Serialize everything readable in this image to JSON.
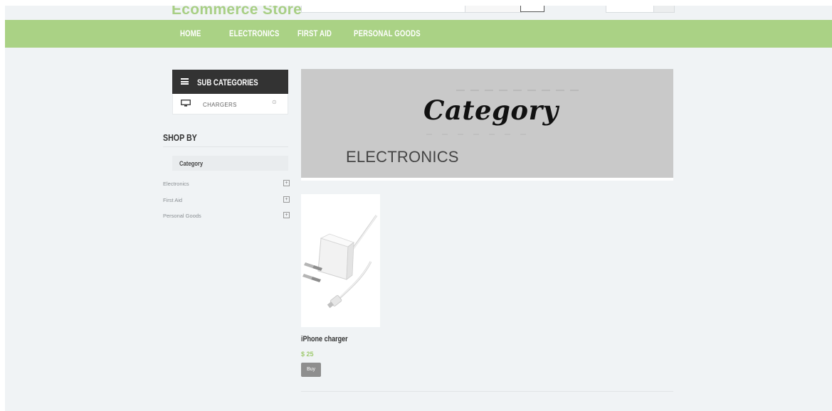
{
  "header": {
    "store_name": "Ecommerce Store"
  },
  "nav": {
    "items": [
      {
        "label": "HOME"
      },
      {
        "label": "ELECTRONICS"
      },
      {
        "label": "FIRST AID"
      },
      {
        "label": "PERSONAL GOODS"
      }
    ]
  },
  "sidebar": {
    "subcategories_title": "SUB CATEGORIES",
    "subcategories": [
      {
        "label": "CHARGERS",
        "icon": "monitor-icon"
      }
    ],
    "shop_by_title": "SHOP BY",
    "category_box_label": "Category",
    "filters": [
      {
        "label": "Electronics",
        "icon": "plus-square-icon"
      },
      {
        "label": "First Aid",
        "icon": "plus-square-icon"
      },
      {
        "label": "Personal Goods",
        "icon": "plus-square-icon"
      }
    ]
  },
  "banner": {
    "script_text": "Category",
    "heading": "ELECTRONICS"
  },
  "products": [
    {
      "name": "iPhone charger",
      "price": "$ 25",
      "buy_label": "Buy"
    }
  ],
  "colors": {
    "navbar": "#aad285",
    "brand_green": "#a8cf85",
    "price_green": "#9fca6f",
    "sidebar_header": "#333333",
    "page_background": "#f0f3f5",
    "banner_background": "#c9c9c9"
  }
}
